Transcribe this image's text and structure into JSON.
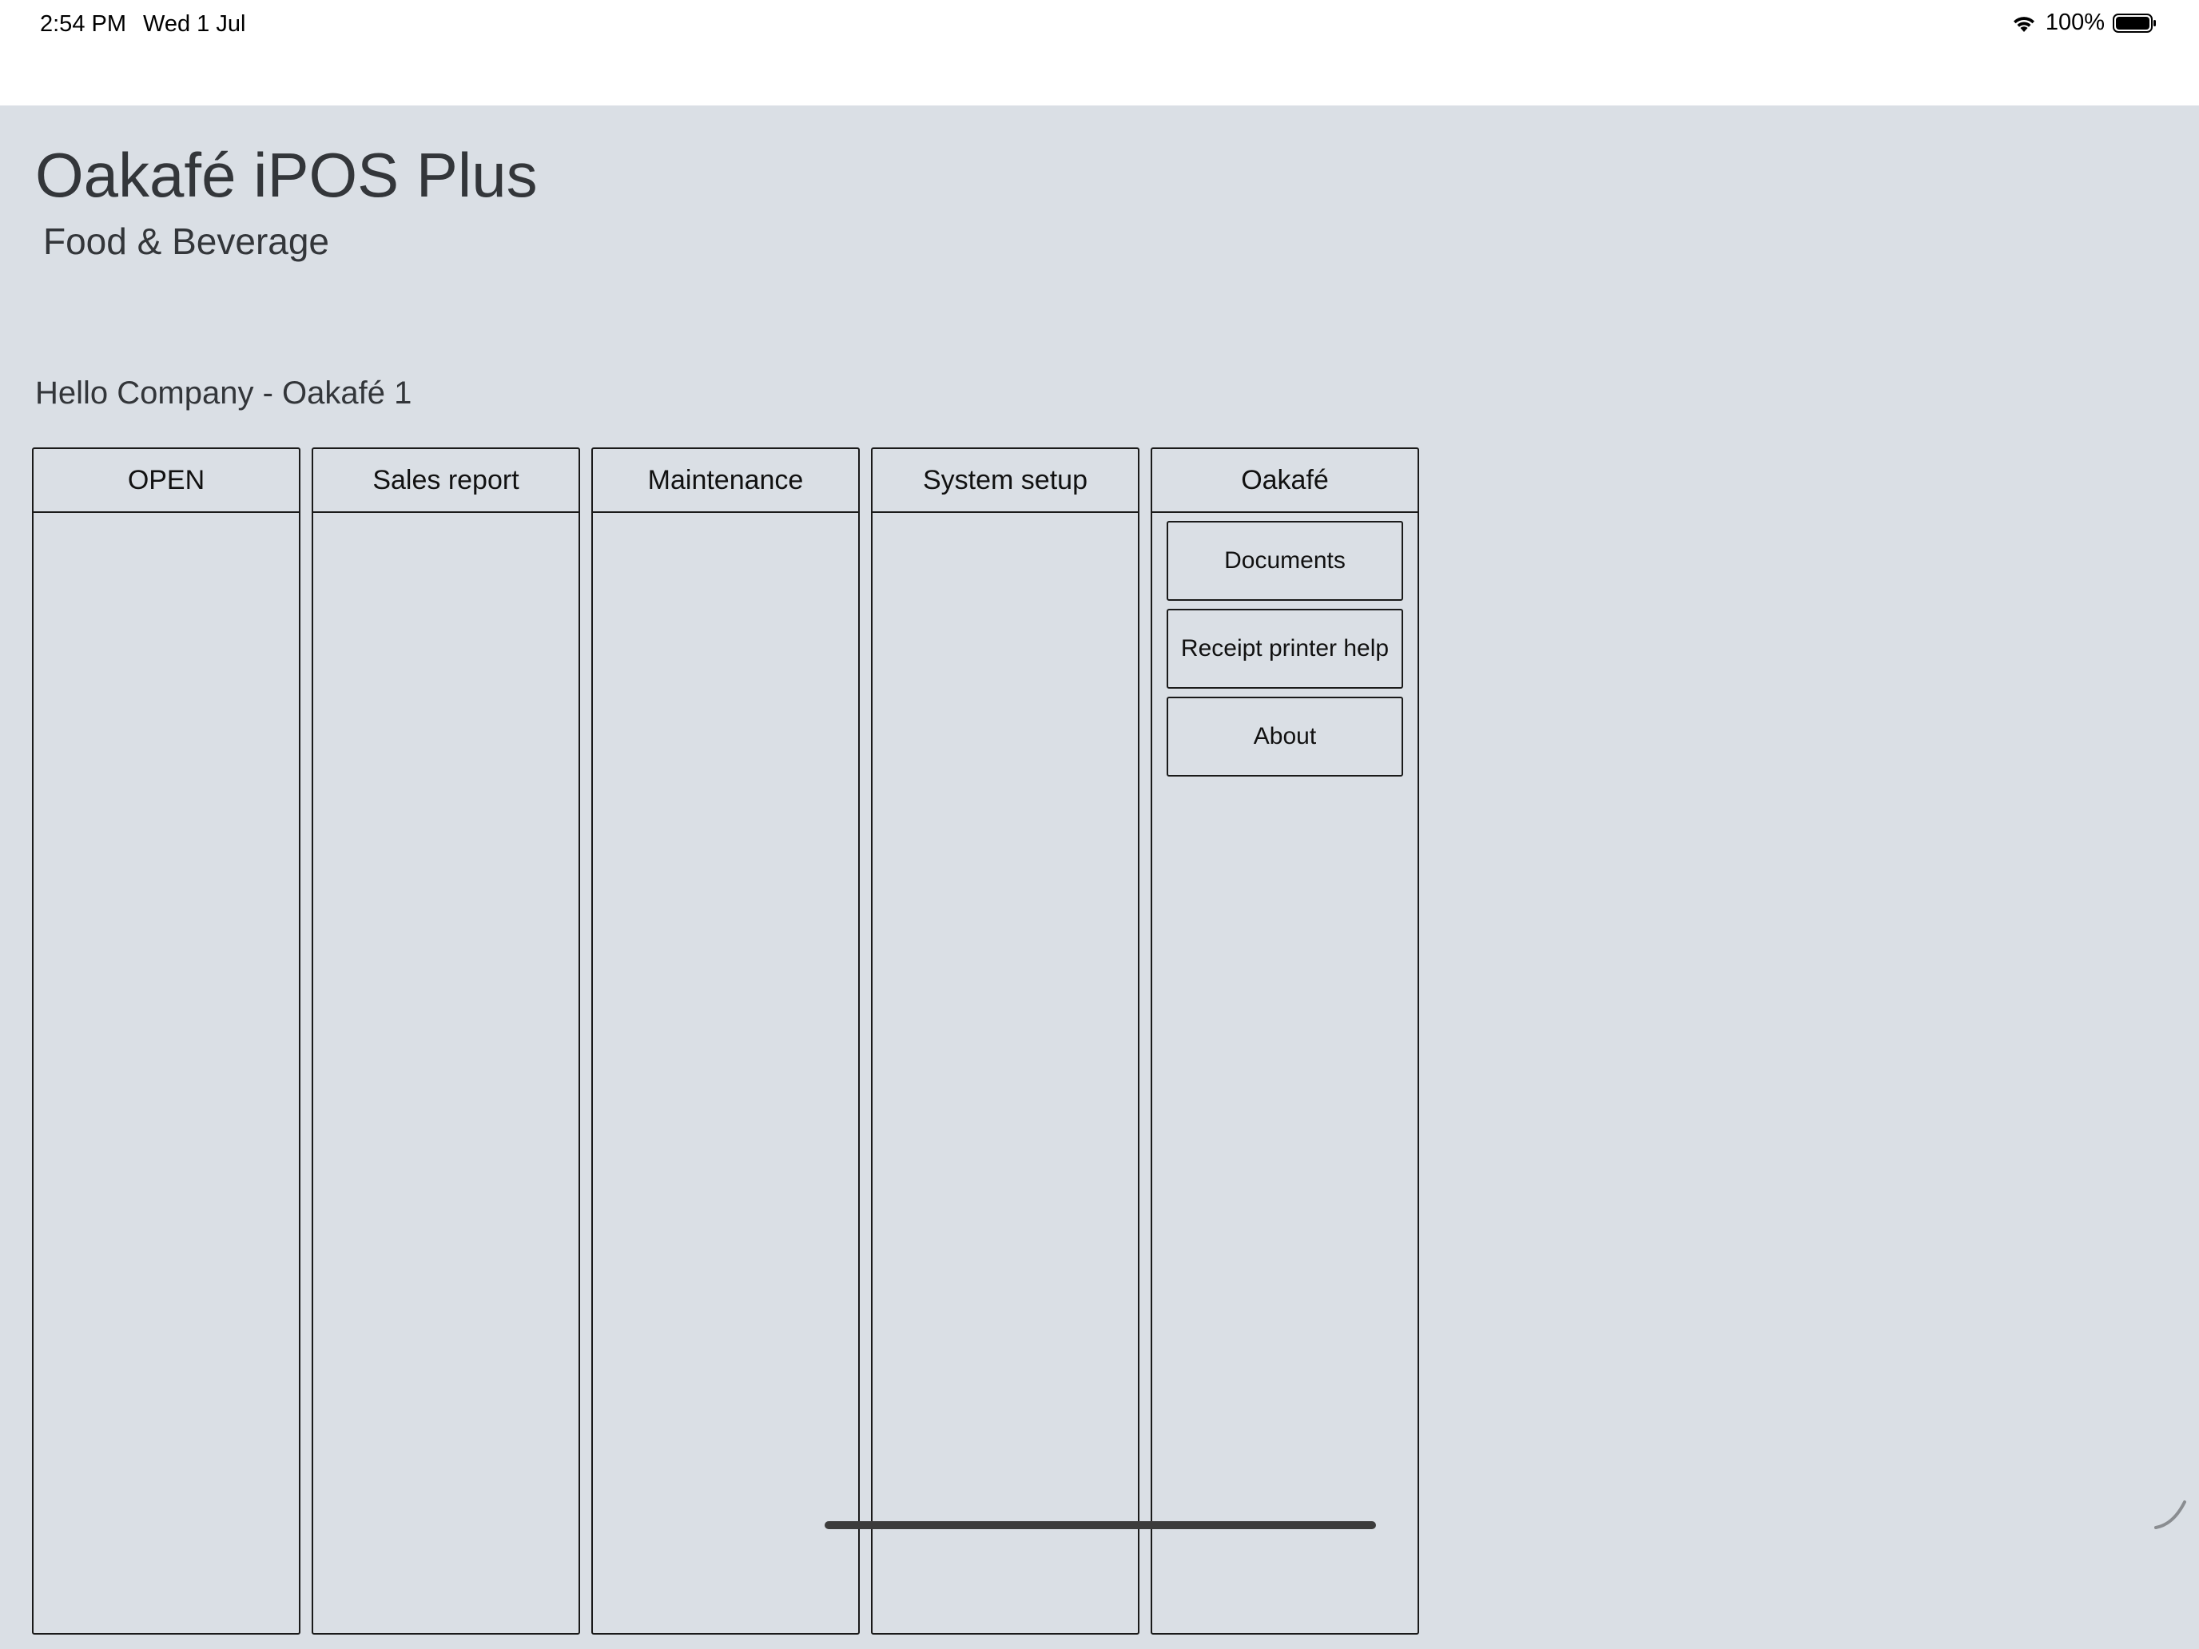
{
  "status_bar": {
    "time": "2:54 PM",
    "date": "Wed 1 Jul",
    "battery": "100%",
    "icons": [
      "wifi-icon",
      "battery-icon"
    ]
  },
  "header": {
    "title": "Oakafé iPOS Plus",
    "subtitle": "Food & Beverage"
  },
  "greeting": "Hello Company - Oakafé 1",
  "columns": [
    {
      "label": "OPEN",
      "buttons": []
    },
    {
      "label": "Sales report",
      "buttons": []
    },
    {
      "label": "Maintenance",
      "buttons": []
    },
    {
      "label": "System setup",
      "buttons": []
    },
    {
      "label": "Oakafé",
      "buttons": [
        "Documents",
        "Receipt printer help",
        "About"
      ]
    }
  ],
  "colors": {
    "background": "#dadfe5",
    "border": "#1a1a1a",
    "text": "#33363a"
  }
}
